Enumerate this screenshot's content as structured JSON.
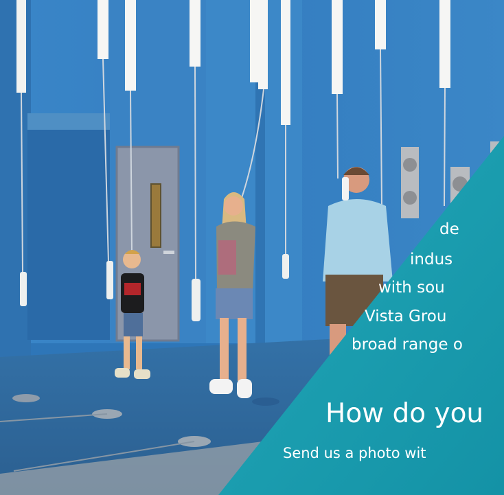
{
  "overlay": {
    "accent_color": "#1a9aad",
    "lines": [
      "de",
      "indus",
      "with sou",
      "Vista Grou",
      "broad range o"
    ],
    "headline": "How do you",
    "cta": "Send us a photo wit"
  },
  "photo": {
    "subject": "museum-visitors-listening-to-hanging-telephone-handsets",
    "wall_color": "#3d86c6",
    "floor_color": "#2f6a9e"
  }
}
